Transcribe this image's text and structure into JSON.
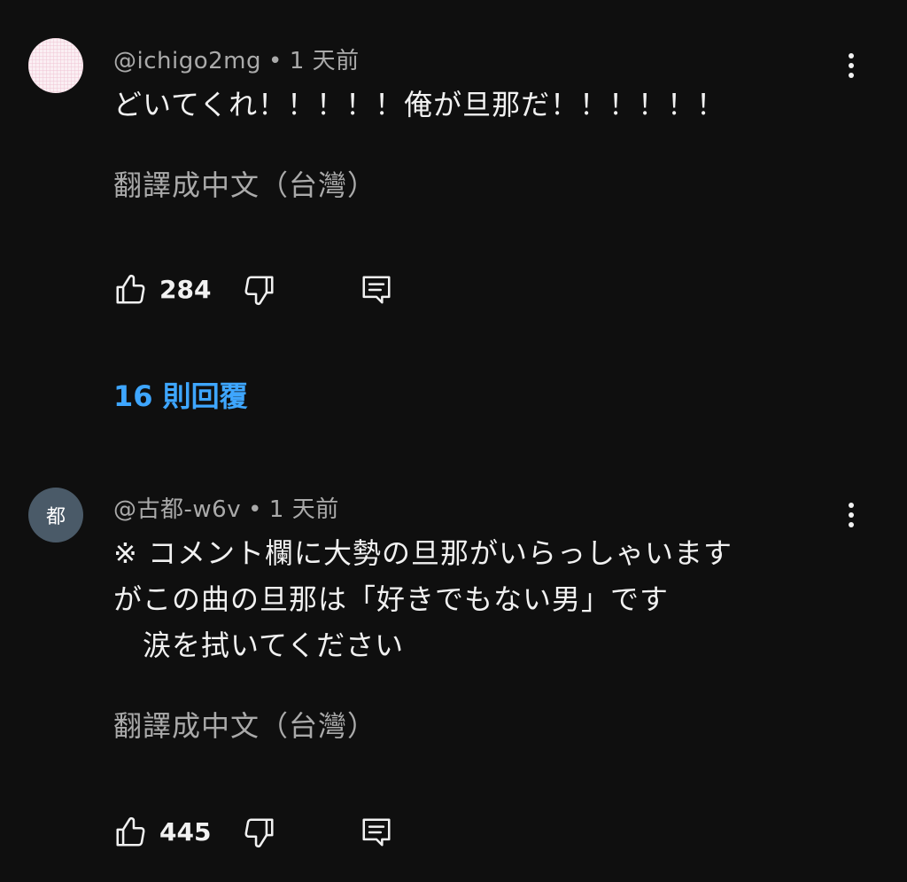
{
  "comments": [
    {
      "handle": "@ichigo2mg",
      "separator": "•",
      "time": "1 天前",
      "avatar_icon": "pink-gingham-avatar",
      "text": "どいてくれ！！！！！俺が旦那だ！！！！！！",
      "translate_label": "翻譯成中文（台灣）",
      "likes": "284",
      "replies_label": "16 則回覆"
    },
    {
      "handle": "@古都-w6v",
      "separator": "•",
      "time": "1 天前",
      "avatar_letter": "都",
      "text": "※ コメント欄に大勢の旦那がいらっしゃいます\nがこの曲の旦那は「好きでもない男」です\n　涙を拭いてください",
      "translate_label": "翻譯成中文（台灣）",
      "likes": "445"
    }
  ],
  "colors": {
    "background": "#0f0f0f",
    "primary_text": "#f1f1f1",
    "secondary_text": "#aaaaaa",
    "link_blue": "#3ea6ff"
  },
  "icons": [
    "thumb-up-icon",
    "thumb-down-icon",
    "reply-comment-icon",
    "more-vertical-icon"
  ]
}
